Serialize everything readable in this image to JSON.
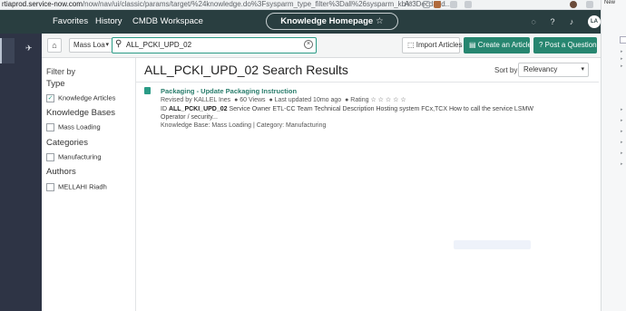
{
  "browser": {
    "url_domain": "rtiaprod.service-now.com",
    "url_path": "/now/nav/ui/classic/params/target/%24knowledge.do%3Fsysparm_type_filter%3Dall%26sysparm_kb%3Decd37d...",
    "reader_label": "A⁺",
    "right_tab_label": "New"
  },
  "topnav": {
    "favorites": "Favorites",
    "history": "History",
    "workspace": "CMDB Workspace",
    "context": "Knowledge Homepage",
    "star": "☆",
    "avatar": "LA"
  },
  "toolbar": {
    "kb_select": "Mass Loa",
    "search_value": "ALL_PCKI_UPD_02",
    "import_label": "Import Articles",
    "create_label": "Create an Article",
    "post_label": "Post a Question"
  },
  "filters": {
    "heading": "Filter by",
    "type_title": "Type",
    "type_option": "Knowledge Articles",
    "kb_title": "Knowledge Bases",
    "kb_option": "Mass Loading",
    "cat_title": "Categories",
    "cat_option": "Manufacturing",
    "auth_title": "Authors",
    "auth_option": "MELLAHI Riadh"
  },
  "results": {
    "title": "ALL_PCKI_UPD_02 Search Results",
    "sort_label": "Sort by",
    "sort_value": "Relevancy",
    "article": {
      "title": "Packaging - Update Packaging Instruction",
      "revised": "Revised by KALLEL Ines",
      "views": "60 Views",
      "updated": "Last updated 10mo ago",
      "rating_label": "Rating",
      "rating_stars": "☆ ☆ ☆ ☆ ☆",
      "desc_prefix": "ID ",
      "desc_id": "ALL_PCKI_UPD_02",
      "desc_rest": " Service Owner ETL-CC Team Technical Description Hosting system FCx,TCX How to call the service LSMW Operator / security...",
      "kb_line": "Knowledge Base: Mass Loading | Category: Manufacturing"
    }
  },
  "colors": {
    "nav_bg": "#293e40",
    "left_nav_bg": "#2e3445",
    "accent": "#278670",
    "link": "#2a7d6c"
  }
}
